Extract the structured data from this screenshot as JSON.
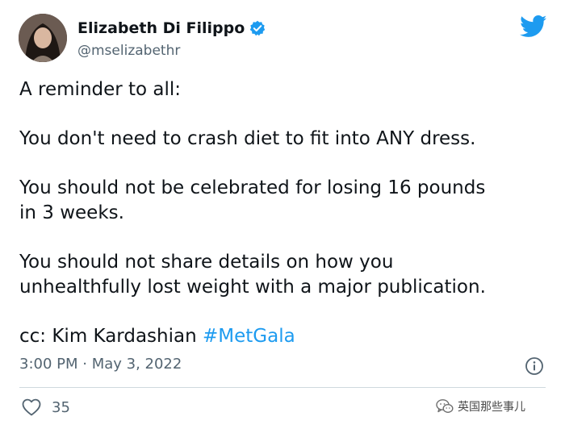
{
  "author": {
    "display_name": "Elizabeth Di Filippo",
    "handle": "@mselizabethr",
    "verified": true
  },
  "tweet": {
    "paragraphs": [
      "A reminder to all:",
      "You don't need to crash diet to fit into ANY dress.",
      "You should not be celebrated for losing 16 pounds",
      "in 3 weeks.",
      "You should not share details on how you",
      "unhealthfully lost weight with a major publication.",
      "cc: Kim Kardashian ",
      "#MetGala"
    ],
    "timestamp": "3:00 PM · May 3, 2022"
  },
  "engagement": {
    "likes": "35"
  },
  "watermark": {
    "text": "英国那些事儿"
  },
  "icons": [
    "twitter-bird-icon",
    "verified-badge-icon",
    "info-icon",
    "heart-icon",
    "wechat-logo-icon"
  ],
  "colors": {
    "link": "#1d9bf0",
    "twitter_blue": "#1d9bf0",
    "secondary_text": "#536471"
  }
}
